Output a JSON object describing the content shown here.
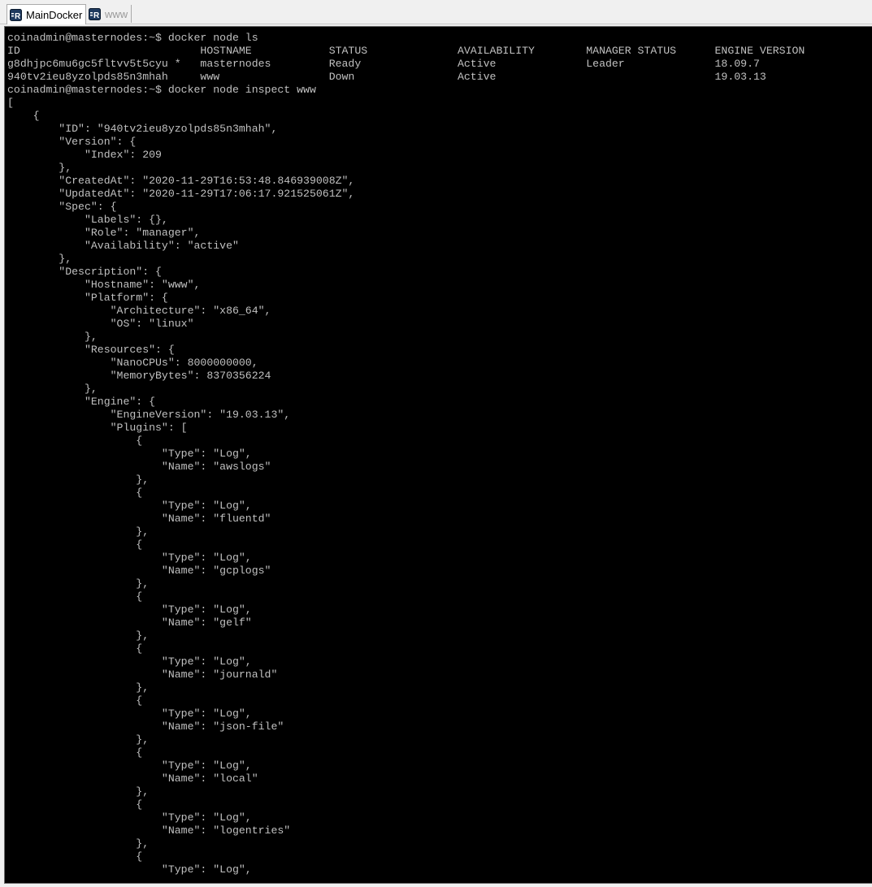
{
  "window": {
    "tabs": [
      {
        "label": "MainDocker",
        "icon": "app-icon",
        "active": true
      },
      {
        "label": "www",
        "icon": "app-icon",
        "active": false
      }
    ]
  },
  "colors": {
    "terminal_bg": "#000000",
    "terminal_fg": "#c0c0c0",
    "tab_active_bg": "#ffffff",
    "tab_inactive_fg": "#9a9a9a",
    "icon_bg": "#1f3a5f"
  },
  "terminal": {
    "lines": [
      "coinadmin@masternodes:~$ docker node ls",
      "ID                            HOSTNAME            STATUS              AVAILABILITY        MANAGER STATUS      ENGINE VERSION",
      "g8dhjpc6mu6gc5fltvv5t5cyu *   masternodes         Ready               Active              Leader              18.09.7",
      "940tv2ieu8yzolpds85n3mhah     www                 Down                Active                                  19.03.13",
      "coinadmin@masternodes:~$ docker node inspect www",
      "[",
      "    {",
      "        \"ID\": \"940tv2ieu8yzolpds85n3mhah\",",
      "        \"Version\": {",
      "            \"Index\": 209",
      "        },",
      "        \"CreatedAt\": \"2020-11-29T16:53:48.846939008Z\",",
      "        \"UpdatedAt\": \"2020-11-29T17:06:17.921525061Z\",",
      "        \"Spec\": {",
      "            \"Labels\": {},",
      "            \"Role\": \"manager\",",
      "            \"Availability\": \"active\"",
      "        },",
      "        \"Description\": {",
      "            \"Hostname\": \"www\",",
      "            \"Platform\": {",
      "                \"Architecture\": \"x86_64\",",
      "                \"OS\": \"linux\"",
      "            },",
      "            \"Resources\": {",
      "                \"NanoCPUs\": 8000000000,",
      "                \"MemoryBytes\": 8370356224",
      "            },",
      "            \"Engine\": {",
      "                \"EngineVersion\": \"19.03.13\",",
      "                \"Plugins\": [",
      "                    {",
      "                        \"Type\": \"Log\",",
      "                        \"Name\": \"awslogs\"",
      "                    },",
      "                    {",
      "                        \"Type\": \"Log\",",
      "                        \"Name\": \"fluentd\"",
      "                    },",
      "                    {",
      "                        \"Type\": \"Log\",",
      "                        \"Name\": \"gcplogs\"",
      "                    },",
      "                    {",
      "                        \"Type\": \"Log\",",
      "                        \"Name\": \"gelf\"",
      "                    },",
      "                    {",
      "                        \"Type\": \"Log\",",
      "                        \"Name\": \"journald\"",
      "                    },",
      "                    {",
      "                        \"Type\": \"Log\",",
      "                        \"Name\": \"json-file\"",
      "                    },",
      "                    {",
      "                        \"Type\": \"Log\",",
      "                        \"Name\": \"local\"",
      "                    },",
      "                    {",
      "                        \"Type\": \"Log\",",
      "                        \"Name\": \"logentries\"",
      "                    },",
      "                    {",
      "                        \"Type\": \"Log\","
    ]
  }
}
